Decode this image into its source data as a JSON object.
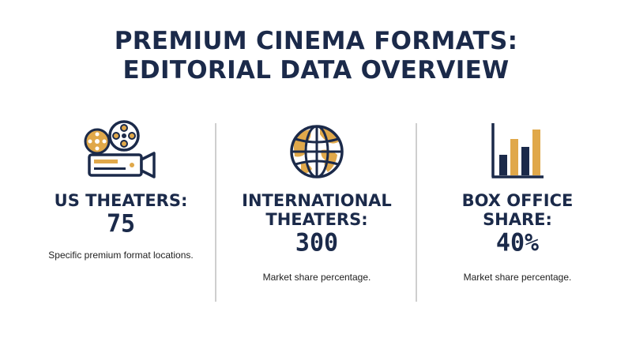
{
  "title": {
    "line1": "PREMIUM CINEMA FORMATS:",
    "line2": "EDITORIAL DATA OVERVIEW"
  },
  "colors": {
    "navy": "#1b2a4a",
    "gold": "#e0a84a",
    "divider": "#cfcfcf"
  },
  "stats": [
    {
      "icon": "film-camera-icon",
      "label_lines": [
        "US THEATERS:"
      ],
      "value": "75",
      "description": "Specific premium format locations."
    },
    {
      "icon": "globe-icon",
      "label_lines": [
        "INTERNATIONAL",
        "THEATERS:"
      ],
      "value": "300",
      "description": "Market share percentage."
    },
    {
      "icon": "bar-chart-icon",
      "label_lines": [
        "BOX OFFICE",
        "SHARE:"
      ],
      "value": "40%",
      "description": "Market share percentage."
    }
  ]
}
